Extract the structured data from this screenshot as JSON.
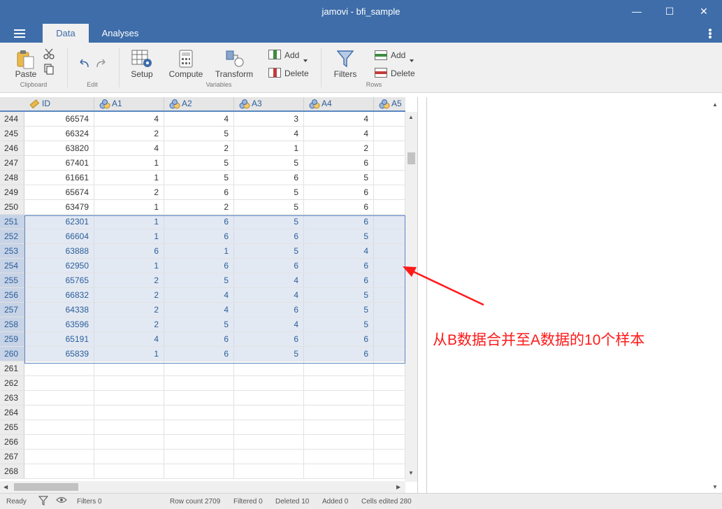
{
  "window": {
    "title": "jamovi - bfi_sample",
    "minimize": "—",
    "maximize": "☐",
    "close": "✕"
  },
  "tabs": [
    {
      "label": "Data",
      "active": true
    },
    {
      "label": "Analyses",
      "active": false
    }
  ],
  "ribbon": {
    "clipboard": {
      "paste": "Paste",
      "group": "Clipboard"
    },
    "edit": {
      "group": "Edit"
    },
    "variables": {
      "setup": "Setup",
      "compute": "Compute",
      "transform": "Transform",
      "add": "Add",
      "delete": "Delete",
      "group": "Variables"
    },
    "rows": {
      "filters": "Filters",
      "add": "Add",
      "delete": "Delete",
      "group": "Rows"
    }
  },
  "columns": [
    "ID",
    "A1",
    "A2",
    "A3",
    "A4",
    "A5"
  ],
  "rows": [
    {
      "n": "244",
      "id": "66574",
      "a1": "4",
      "a2": "4",
      "a3": "3",
      "a4": "4",
      "sel": false
    },
    {
      "n": "245",
      "id": "66324",
      "a1": "2",
      "a2": "5",
      "a3": "4",
      "a4": "4",
      "sel": false
    },
    {
      "n": "246",
      "id": "63820",
      "a1": "4",
      "a2": "2",
      "a3": "1",
      "a4": "2",
      "sel": false
    },
    {
      "n": "247",
      "id": "67401",
      "a1": "1",
      "a2": "5",
      "a3": "5",
      "a4": "6",
      "sel": false
    },
    {
      "n": "248",
      "id": "61661",
      "a1": "1",
      "a2": "5",
      "a3": "6",
      "a4": "5",
      "sel": false
    },
    {
      "n": "249",
      "id": "65674",
      "a1": "2",
      "a2": "6",
      "a3": "5",
      "a4": "6",
      "sel": false
    },
    {
      "n": "250",
      "id": "63479",
      "a1": "1",
      "a2": "2",
      "a3": "5",
      "a4": "6",
      "sel": false
    },
    {
      "n": "251",
      "id": "62301",
      "a1": "1",
      "a2": "6",
      "a3": "5",
      "a4": "6",
      "sel": true
    },
    {
      "n": "252",
      "id": "66604",
      "a1": "1",
      "a2": "6",
      "a3": "6",
      "a4": "5",
      "sel": true
    },
    {
      "n": "253",
      "id": "63888",
      "a1": "6",
      "a2": "1",
      "a3": "5",
      "a4": "4",
      "sel": true
    },
    {
      "n": "254",
      "id": "62950",
      "a1": "1",
      "a2": "6",
      "a3": "6",
      "a4": "6",
      "sel": true
    },
    {
      "n": "255",
      "id": "65765",
      "a1": "2",
      "a2": "5",
      "a3": "4",
      "a4": "6",
      "sel": true
    },
    {
      "n": "256",
      "id": "66832",
      "a1": "2",
      "a2": "4",
      "a3": "4",
      "a4": "5",
      "sel": true
    },
    {
      "n": "257",
      "id": "64338",
      "a1": "2",
      "a2": "4",
      "a3": "6",
      "a4": "5",
      "sel": true
    },
    {
      "n": "258",
      "id": "63596",
      "a1": "2",
      "a2": "5",
      "a3": "4",
      "a4": "5",
      "sel": true
    },
    {
      "n": "259",
      "id": "65191",
      "a1": "4",
      "a2": "6",
      "a3": "6",
      "a4": "6",
      "sel": true
    },
    {
      "n": "260",
      "id": "65839",
      "a1": "1",
      "a2": "6",
      "a3": "5",
      "a4": "6",
      "sel": true
    },
    {
      "n": "261",
      "id": "",
      "a1": "",
      "a2": "",
      "a3": "",
      "a4": "",
      "sel": false
    },
    {
      "n": "262",
      "id": "",
      "a1": "",
      "a2": "",
      "a3": "",
      "a4": "",
      "sel": false
    },
    {
      "n": "263",
      "id": "",
      "a1": "",
      "a2": "",
      "a3": "",
      "a4": "",
      "sel": false
    },
    {
      "n": "264",
      "id": "",
      "a1": "",
      "a2": "",
      "a3": "",
      "a4": "",
      "sel": false
    },
    {
      "n": "265",
      "id": "",
      "a1": "",
      "a2": "",
      "a3": "",
      "a4": "",
      "sel": false
    },
    {
      "n": "266",
      "id": "",
      "a1": "",
      "a2": "",
      "a3": "",
      "a4": "",
      "sel": false
    },
    {
      "n": "267",
      "id": "",
      "a1": "",
      "a2": "",
      "a3": "",
      "a4": "",
      "sel": false
    },
    {
      "n": "268",
      "id": "",
      "a1": "",
      "a2": "",
      "a3": "",
      "a4": "",
      "sel": false
    }
  ],
  "annotation": "从B数据合并至A数据的10个样本",
  "status": {
    "ready": "Ready",
    "filters": "Filters 0",
    "row_count": "Row count 2709",
    "filtered": "Filtered 0",
    "deleted": "Deleted 10",
    "added": "Added 0",
    "cells_edited": "Cells edited 280"
  },
  "colors": {
    "accent": "#3e6da9",
    "selection": "#e3e9f3",
    "annotation": "#ff1a1a"
  }
}
